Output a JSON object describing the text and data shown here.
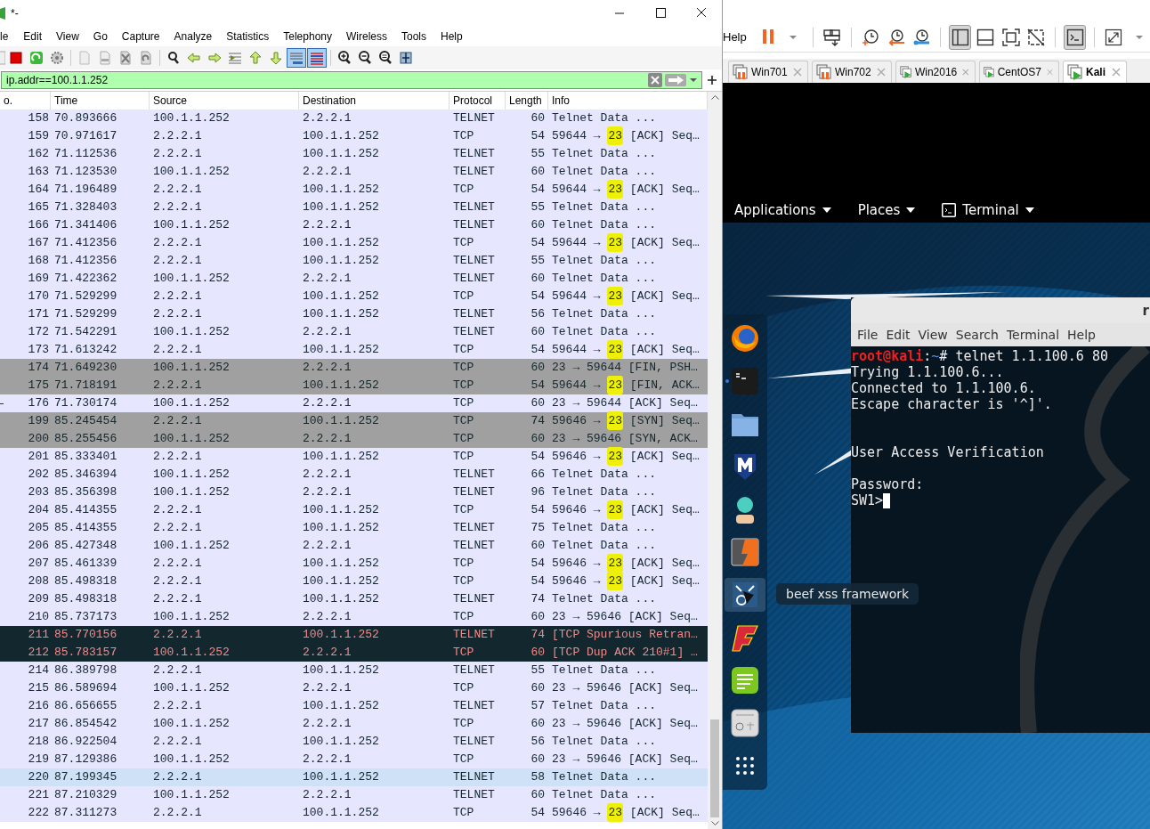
{
  "wireshark": {
    "title": "*-",
    "menu": [
      "le",
      "Edit",
      "View",
      "Go",
      "Capture",
      "Analyze",
      "Statistics",
      "Telephony",
      "Wireless",
      "Tools",
      "Help"
    ],
    "toolbar": [
      {
        "kind": "stop",
        "pressed": false
      },
      {
        "kind": "restart",
        "pressed": false
      },
      {
        "kind": "options",
        "pressed": false
      },
      {
        "kind": "sep"
      },
      {
        "kind": "open",
        "pressed": false
      },
      {
        "kind": "save",
        "pressed": false
      },
      {
        "kind": "close",
        "pressed": false
      },
      {
        "kind": "reload",
        "pressed": false
      },
      {
        "kind": "sep"
      },
      {
        "kind": "find",
        "pressed": false
      },
      {
        "kind": "back",
        "pressed": false
      },
      {
        "kind": "forward",
        "pressed": false
      },
      {
        "kind": "goto",
        "pressed": false
      },
      {
        "kind": "first",
        "pressed": false
      },
      {
        "kind": "last",
        "pressed": false
      },
      {
        "kind": "autoscroll",
        "pressed": true
      },
      {
        "kind": "colorize",
        "pressed": true
      },
      {
        "kind": "sep"
      },
      {
        "kind": "zoomin",
        "pressed": false
      },
      {
        "kind": "zoomout",
        "pressed": false
      },
      {
        "kind": "zoomreset",
        "pressed": false
      },
      {
        "kind": "resize",
        "pressed": false
      }
    ],
    "filter": {
      "value": "ip.addr==100.1.1.252"
    },
    "columns": [
      "o.",
      "Time",
      "Source",
      "Destination",
      "Protocol",
      "Length",
      "Info"
    ],
    "rows": [
      {
        "no": "158",
        "time": "70.893666",
        "source": "100.1.1.252",
        "destination": "2.2.2.1",
        "protocol": "TELNET",
        "length": "60",
        "info": [
          {
            "text": "Telnet Data ...",
            "marked": false
          }
        ],
        "kind": "normal",
        "related": false
      },
      {
        "no": "159",
        "time": "70.971617",
        "source": "2.2.2.1",
        "destination": "100.1.1.252",
        "protocol": "TCP",
        "length": "54",
        "info": [
          {
            "text": "59644 → ",
            "marked": false
          },
          {
            "text": "23",
            "marked": true
          },
          {
            "text": " [ACK] Seq…",
            "marked": false
          }
        ],
        "kind": "normal",
        "related": false
      },
      {
        "no": "162",
        "time": "71.112536",
        "source": "2.2.2.1",
        "destination": "100.1.1.252",
        "protocol": "TELNET",
        "length": "55",
        "info": [
          {
            "text": "Telnet Data ...",
            "marked": false
          }
        ],
        "kind": "normal",
        "related": false
      },
      {
        "no": "163",
        "time": "71.123530",
        "source": "100.1.1.252",
        "destination": "2.2.2.1",
        "protocol": "TELNET",
        "length": "60",
        "info": [
          {
            "text": "Telnet Data ...",
            "marked": false
          }
        ],
        "kind": "normal",
        "related": false
      },
      {
        "no": "164",
        "time": "71.196489",
        "source": "2.2.2.1",
        "destination": "100.1.1.252",
        "protocol": "TCP",
        "length": "54",
        "info": [
          {
            "text": "59644 → ",
            "marked": false
          },
          {
            "text": "23",
            "marked": true
          },
          {
            "text": " [ACK] Seq…",
            "marked": false
          }
        ],
        "kind": "normal",
        "related": false
      },
      {
        "no": "165",
        "time": "71.328403",
        "source": "2.2.2.1",
        "destination": "100.1.1.252",
        "protocol": "TELNET",
        "length": "55",
        "info": [
          {
            "text": "Telnet Data ...",
            "marked": false
          }
        ],
        "kind": "normal",
        "related": false
      },
      {
        "no": "166",
        "time": "71.341406",
        "source": "100.1.1.252",
        "destination": "2.2.2.1",
        "protocol": "TELNET",
        "length": "60",
        "info": [
          {
            "text": "Telnet Data ...",
            "marked": false
          }
        ],
        "kind": "normal",
        "related": false
      },
      {
        "no": "167",
        "time": "71.412356",
        "source": "2.2.2.1",
        "destination": "100.1.1.252",
        "protocol": "TCP",
        "length": "54",
        "info": [
          {
            "text": "59644 → ",
            "marked": false
          },
          {
            "text": "23",
            "marked": true
          },
          {
            "text": " [ACK] Seq…",
            "marked": false
          }
        ],
        "kind": "normal",
        "related": false
      },
      {
        "no": "168",
        "time": "71.412356",
        "source": "2.2.2.1",
        "destination": "100.1.1.252",
        "protocol": "TELNET",
        "length": "55",
        "info": [
          {
            "text": "Telnet Data ...",
            "marked": false
          }
        ],
        "kind": "normal",
        "related": false
      },
      {
        "no": "169",
        "time": "71.422362",
        "source": "100.1.1.252",
        "destination": "2.2.2.1",
        "protocol": "TELNET",
        "length": "60",
        "info": [
          {
            "text": "Telnet Data ...",
            "marked": false
          }
        ],
        "kind": "normal",
        "related": false
      },
      {
        "no": "170",
        "time": "71.529299",
        "source": "2.2.2.1",
        "destination": "100.1.1.252",
        "protocol": "TCP",
        "length": "54",
        "info": [
          {
            "text": "59644 → ",
            "marked": false
          },
          {
            "text": "23",
            "marked": true
          },
          {
            "text": " [ACK] Seq…",
            "marked": false
          }
        ],
        "kind": "normal",
        "related": false
      },
      {
        "no": "171",
        "time": "71.529299",
        "source": "2.2.2.1",
        "destination": "100.1.1.252",
        "protocol": "TELNET",
        "length": "56",
        "info": [
          {
            "text": "Telnet Data ...",
            "marked": false
          }
        ],
        "kind": "normal",
        "related": false
      },
      {
        "no": "172",
        "time": "71.542291",
        "source": "100.1.1.252",
        "destination": "2.2.2.1",
        "protocol": "TELNET",
        "length": "60",
        "info": [
          {
            "text": "Telnet Data ...",
            "marked": false
          }
        ],
        "kind": "normal",
        "related": false
      },
      {
        "no": "173",
        "time": "71.613242",
        "source": "2.2.2.1",
        "destination": "100.1.1.252",
        "protocol": "TCP",
        "length": "54",
        "info": [
          {
            "text": "59644 → ",
            "marked": false
          },
          {
            "text": "23",
            "marked": true
          },
          {
            "text": " [ACK] Seq…",
            "marked": false
          }
        ],
        "kind": "normal",
        "related": false
      },
      {
        "no": "174",
        "time": "71.649230",
        "source": "100.1.1.252",
        "destination": "2.2.2.1",
        "protocol": "TCP",
        "length": "60",
        "info": [
          {
            "text": "23 → 59644 [FIN, PSH…",
            "marked": false
          }
        ],
        "kind": "flags",
        "related": false
      },
      {
        "no": "175",
        "time": "71.718191",
        "source": "2.2.2.1",
        "destination": "100.1.1.252",
        "protocol": "TCP",
        "length": "54",
        "info": [
          {
            "text": "59644 → ",
            "marked": false
          },
          {
            "text": "23",
            "marked": true
          },
          {
            "text": " [FIN, ACK…",
            "marked": false
          }
        ],
        "kind": "flags",
        "related": false
      },
      {
        "no": "176",
        "time": "71.730174",
        "source": "100.1.1.252",
        "destination": "2.2.2.1",
        "protocol": "TCP",
        "length": "60",
        "info": [
          {
            "text": "23 → 59644 [ACK] Seq…",
            "marked": false
          }
        ],
        "kind": "normal",
        "related": true
      },
      {
        "no": "199",
        "time": "85.245454",
        "source": "2.2.2.1",
        "destination": "100.1.1.252",
        "protocol": "TCP",
        "length": "74",
        "info": [
          {
            "text": "59646 → ",
            "marked": false
          },
          {
            "text": "23",
            "marked": true
          },
          {
            "text": " [SYN] Seq…",
            "marked": false
          }
        ],
        "kind": "flags",
        "related": false
      },
      {
        "no": "200",
        "time": "85.255456",
        "source": "100.1.1.252",
        "destination": "2.2.2.1",
        "protocol": "TCP",
        "length": "60",
        "info": [
          {
            "text": "23 → 59646 [SYN, ACK…",
            "marked": false
          }
        ],
        "kind": "flags",
        "related": false
      },
      {
        "no": "201",
        "time": "85.333401",
        "source": "2.2.2.1",
        "destination": "100.1.1.252",
        "protocol": "TCP",
        "length": "54",
        "info": [
          {
            "text": "59646 → ",
            "marked": false
          },
          {
            "text": "23",
            "marked": true
          },
          {
            "text": " [ACK] Seq…",
            "marked": false
          }
        ],
        "kind": "normal",
        "related": false
      },
      {
        "no": "202",
        "time": "85.346394",
        "source": "100.1.1.252",
        "destination": "2.2.2.1",
        "protocol": "TELNET",
        "length": "66",
        "info": [
          {
            "text": "Telnet Data ...",
            "marked": false
          }
        ],
        "kind": "normal",
        "related": false
      },
      {
        "no": "203",
        "time": "85.356398",
        "source": "100.1.1.252",
        "destination": "2.2.2.1",
        "protocol": "TELNET",
        "length": "96",
        "info": [
          {
            "text": "Telnet Data ...",
            "marked": false
          }
        ],
        "kind": "normal",
        "related": false
      },
      {
        "no": "204",
        "time": "85.414355",
        "source": "2.2.2.1",
        "destination": "100.1.1.252",
        "protocol": "TCP",
        "length": "54",
        "info": [
          {
            "text": "59646 → ",
            "marked": false
          },
          {
            "text": "23",
            "marked": true
          },
          {
            "text": " [ACK] Seq…",
            "marked": false
          }
        ],
        "kind": "normal",
        "related": false
      },
      {
        "no": "205",
        "time": "85.414355",
        "source": "2.2.2.1",
        "destination": "100.1.1.252",
        "protocol": "TELNET",
        "length": "75",
        "info": [
          {
            "text": "Telnet Data ...",
            "marked": false
          }
        ],
        "kind": "normal",
        "related": false
      },
      {
        "no": "206",
        "time": "85.427348",
        "source": "100.1.1.252",
        "destination": "2.2.2.1",
        "protocol": "TELNET",
        "length": "60",
        "info": [
          {
            "text": "Telnet Data ...",
            "marked": false
          }
        ],
        "kind": "normal",
        "related": false
      },
      {
        "no": "207",
        "time": "85.461339",
        "source": "2.2.2.1",
        "destination": "100.1.1.252",
        "protocol": "TCP",
        "length": "54",
        "info": [
          {
            "text": "59646 → ",
            "marked": false
          },
          {
            "text": "23",
            "marked": true
          },
          {
            "text": " [ACK] Seq…",
            "marked": false
          }
        ],
        "kind": "normal",
        "related": false
      },
      {
        "no": "208",
        "time": "85.498318",
        "source": "2.2.2.1",
        "destination": "100.1.1.252",
        "protocol": "TCP",
        "length": "54",
        "info": [
          {
            "text": "59646 → ",
            "marked": false
          },
          {
            "text": "23",
            "marked": true
          },
          {
            "text": " [ACK] Seq…",
            "marked": false
          }
        ],
        "kind": "normal",
        "related": false
      },
      {
        "no": "209",
        "time": "85.498318",
        "source": "2.2.2.1",
        "destination": "100.1.1.252",
        "protocol": "TELNET",
        "length": "74",
        "info": [
          {
            "text": "Telnet Data ...",
            "marked": false
          }
        ],
        "kind": "normal",
        "related": false
      },
      {
        "no": "210",
        "time": "85.737173",
        "source": "100.1.1.252",
        "destination": "2.2.2.1",
        "protocol": "TCP",
        "length": "60",
        "info": [
          {
            "text": "23 → 59646 [ACK] Seq…",
            "marked": false
          }
        ],
        "kind": "normal",
        "related": false
      },
      {
        "no": "211",
        "time": "85.770156",
        "source": "2.2.2.1",
        "destination": "100.1.1.252",
        "protocol": "TELNET",
        "length": "74",
        "info": [
          {
            "text": "[TCP Spurious Retran…",
            "marked": false
          }
        ],
        "kind": "error",
        "related": false
      },
      {
        "no": "212",
        "time": "85.783157",
        "source": "100.1.1.252",
        "destination": "2.2.2.1",
        "protocol": "TCP",
        "length": "60",
        "info": [
          {
            "text": "[TCP Dup ACK 210#1] …",
            "marked": false
          }
        ],
        "kind": "error",
        "related": false
      },
      {
        "no": "214",
        "time": "86.389798",
        "source": "2.2.2.1",
        "destination": "100.1.1.252",
        "protocol": "TELNET",
        "length": "55",
        "info": [
          {
            "text": "Telnet Data ...",
            "marked": false
          }
        ],
        "kind": "normal",
        "related": false
      },
      {
        "no": "215",
        "time": "86.589694",
        "source": "100.1.1.252",
        "destination": "2.2.2.1",
        "protocol": "TCP",
        "length": "60",
        "info": [
          {
            "text": "23 → 59646 [ACK] Seq…",
            "marked": false
          }
        ],
        "kind": "normal",
        "related": false
      },
      {
        "no": "216",
        "time": "86.656655",
        "source": "2.2.2.1",
        "destination": "100.1.1.252",
        "protocol": "TELNET",
        "length": "57",
        "info": [
          {
            "text": "Telnet Data ...",
            "marked": false
          }
        ],
        "kind": "normal",
        "related": false
      },
      {
        "no": "217",
        "time": "86.854542",
        "source": "100.1.1.252",
        "destination": "2.2.2.1",
        "protocol": "TCP",
        "length": "60",
        "info": [
          {
            "text": "23 → 59646 [ACK] Seq…",
            "marked": false
          }
        ],
        "kind": "normal",
        "related": false
      },
      {
        "no": "218",
        "time": "86.922504",
        "source": "2.2.2.1",
        "destination": "100.1.1.252",
        "protocol": "TELNET",
        "length": "56",
        "info": [
          {
            "text": "Telnet Data ...",
            "marked": false
          }
        ],
        "kind": "normal",
        "related": false
      },
      {
        "no": "219",
        "time": "87.129386",
        "source": "100.1.1.252",
        "destination": "2.2.2.1",
        "protocol": "TCP",
        "length": "60",
        "info": [
          {
            "text": "23 → 59646 [ACK] Seq…",
            "marked": false
          }
        ],
        "kind": "normal",
        "related": false
      },
      {
        "no": "220",
        "time": "87.199345",
        "source": "2.2.2.1",
        "destination": "100.1.1.252",
        "protocol": "TELNET",
        "length": "58",
        "info": [
          {
            "text": "Telnet Data ...",
            "marked": false
          }
        ],
        "kind": "hover",
        "related": false
      },
      {
        "no": "221",
        "time": "87.210329",
        "source": "100.1.1.252",
        "destination": "2.2.2.1",
        "protocol": "TELNET",
        "length": "60",
        "info": [
          {
            "text": "Telnet Data ...",
            "marked": false
          }
        ],
        "kind": "normal",
        "related": false
      },
      {
        "no": "222",
        "time": "87.311273",
        "source": "2.2.2.1",
        "destination": "100.1.1.252",
        "protocol": "TCP",
        "length": "54",
        "info": [
          {
            "text": "59646 → ",
            "marked": false
          },
          {
            "text": "23",
            "marked": true
          },
          {
            "text": " [ACK] Seq…",
            "marked": false
          }
        ],
        "kind": "normal",
        "related": false
      }
    ]
  },
  "vmware": {
    "menu": [
      "Help"
    ],
    "toolbar": [
      {
        "kind": "pause",
        "pressed": false
      },
      {
        "kind": "caret",
        "pressed": false
      },
      {
        "kind": "sep"
      },
      {
        "kind": "send",
        "pressed": false
      },
      {
        "kind": "sep"
      },
      {
        "kind": "snap",
        "pressed": false
      },
      {
        "kind": "revert",
        "pressed": false
      },
      {
        "kind": "manage",
        "pressed": false
      },
      {
        "kind": "sep"
      },
      {
        "kind": "sidebar",
        "pressed": true
      },
      {
        "kind": "bottom",
        "pressed": false
      },
      {
        "kind": "full",
        "pressed": false
      },
      {
        "kind": "unity",
        "pressed": false
      },
      {
        "kind": "sep"
      },
      {
        "kind": "console",
        "pressed": true
      },
      {
        "kind": "sep"
      },
      {
        "kind": "stretch",
        "pressed": false
      },
      {
        "kind": "caret",
        "pressed": false
      }
    ],
    "tabs": [
      {
        "label": "Win701",
        "kind": "paused",
        "selected": false
      },
      {
        "label": "Win702",
        "kind": "paused",
        "selected": false
      },
      {
        "label": "Win2016",
        "kind": "running",
        "selected": false
      },
      {
        "label": "CentOS7",
        "kind": "running",
        "selected": false
      },
      {
        "label": "Kali",
        "kind": "running",
        "selected": true
      }
    ]
  },
  "kali": {
    "panel": [
      {
        "label": "Applications",
        "kind": "plain"
      },
      {
        "label": "Places",
        "kind": "plain"
      },
      {
        "label": "Terminal",
        "kind": "app"
      }
    ],
    "dock": [
      {
        "kind": "browser",
        "running": false,
        "hovered": false
      },
      {
        "kind": "terminal",
        "running": true,
        "hovered": false
      },
      {
        "kind": "folder",
        "running": false,
        "hovered": false
      },
      {
        "kind": "shield",
        "running": false,
        "hovered": false
      },
      {
        "kind": "figure",
        "running": false,
        "hovered": false
      },
      {
        "kind": "bolt",
        "running": false,
        "hovered": false
      },
      {
        "kind": "bull",
        "running": false,
        "hovered": true
      },
      {
        "kind": "slant",
        "running": false,
        "hovered": false
      },
      {
        "kind": "notes",
        "running": false,
        "hovered": false
      },
      {
        "kind": "device",
        "running": false,
        "hovered": false
      },
      {
        "kind": "grid",
        "running": false,
        "hovered": false
      }
    ],
    "tooltip": "beef xss framework",
    "terminal": {
      "title": "r",
      "menu": [
        "File",
        "Edit",
        "View",
        "Search",
        "Terminal",
        "Help"
      ],
      "lines": [
        {
          "kind": "prompt",
          "segments": [
            {
              "kind": "user",
              "text": "root@kali"
            },
            {
              "kind": "plain",
              "text": ":"
            },
            {
              "kind": "path",
              "text": "~"
            },
            {
              "kind": "plain",
              "text": "# telnet 1.1.100.6 80"
            }
          ]
        },
        {
          "kind": "output",
          "segments": [
            {
              "kind": "plain",
              "text": "Trying 1.1.100.6..."
            }
          ]
        },
        {
          "kind": "output",
          "segments": [
            {
              "kind": "plain",
              "text": "Connected to 1.1.100.6."
            }
          ]
        },
        {
          "kind": "output",
          "segments": [
            {
              "kind": "plain",
              "text": "Escape character is '^]'."
            }
          ]
        },
        {
          "kind": "blank"
        },
        {
          "kind": "blank"
        },
        {
          "kind": "output",
          "segments": [
            {
              "kind": "plain",
              "text": "User Access Verification"
            }
          ]
        },
        {
          "kind": "blank"
        },
        {
          "kind": "output",
          "segments": [
            {
              "kind": "plain",
              "text": "Password:"
            }
          ]
        },
        {
          "kind": "input",
          "segments": [
            {
              "kind": "plain",
              "text": "SW1>"
            }
          ]
        }
      ]
    }
  }
}
